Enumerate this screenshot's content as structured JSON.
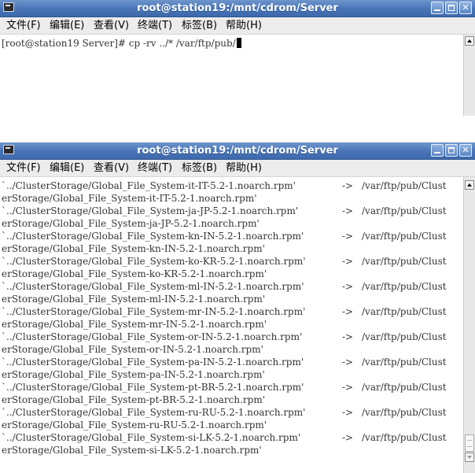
{
  "windows": [
    {
      "title": "root@station19:/mnt/cdrom/Server",
      "menu": [
        "文件(F)",
        "编辑(E)",
        "查看(V)",
        "终端(T)",
        "标签(B)",
        "帮助(H)"
      ],
      "lines": [
        "[root@station19 Server]# cp -rv ../* /var/ftp/pub/"
      ]
    },
    {
      "title": "root@station19:/mnt/cdrom/Server",
      "menu": [
        "文件(F)",
        "编辑(E)",
        "查看(V)",
        "终端(T)",
        "标签(B)",
        "帮助(H)"
      ],
      "arrow": "->",
      "dest": "/var/ftp/pub/Clust",
      "output": [
        {
          "src": "`../ClusterStorage/Global_File_System-it-IT-5.2-1.noarch.rpm'",
          "cont": "erStorage/Global_File_System-it-IT-5.2-1.noarch.rpm'"
        },
        {
          "src": "`../ClusterStorage/Global_File_System-ja-JP-5.2-1.noarch.rpm'",
          "cont": "erStorage/Global_File_System-ja-JP-5.2-1.noarch.rpm'"
        },
        {
          "src": "`../ClusterStorage/Global_File_System-kn-IN-5.2-1.noarch.rpm'",
          "cont": "erStorage/Global_File_System-kn-IN-5.2-1.noarch.rpm'"
        },
        {
          "src": "`../ClusterStorage/Global_File_System-ko-KR-5.2-1.noarch.rpm'",
          "cont": "erStorage/Global_File_System-ko-KR-5.2-1.noarch.rpm'"
        },
        {
          "src": "`../ClusterStorage/Global_File_System-ml-IN-5.2-1.noarch.rpm'",
          "cont": "erStorage/Global_File_System-ml-IN-5.2-1.noarch.rpm'"
        },
        {
          "src": "`../ClusterStorage/Global_File_System-mr-IN-5.2-1.noarch.rpm'",
          "cont": "erStorage/Global_File_System-mr-IN-5.2-1.noarch.rpm'"
        },
        {
          "src": "`../ClusterStorage/Global_File_System-or-IN-5.2-1.noarch.rpm'",
          "cont": "erStorage/Global_File_System-or-IN-5.2-1.noarch.rpm'"
        },
        {
          "src": "`../ClusterStorage/Global_File_System-pa-IN-5.2-1.noarch.rpm'",
          "cont": "erStorage/Global_File_System-pa-IN-5.2-1.noarch.rpm'"
        },
        {
          "src": "`../ClusterStorage/Global_File_System-pt-BR-5.2-1.noarch.rpm'",
          "cont": "erStorage/Global_File_System-pt-BR-5.2-1.noarch.rpm'"
        },
        {
          "src": "`../ClusterStorage/Global_File_System-ru-RU-5.2-1.noarch.rpm'",
          "cont": "erStorage/Global_File_System-ru-RU-5.2-1.noarch.rpm'"
        },
        {
          "src": "`../ClusterStorage/Global_File_System-si-LK-5.2-1.noarch.rpm'",
          "cont": "erStorage/Global_File_System-si-LK-5.2-1.noarch.rpm'"
        }
      ]
    }
  ],
  "colors": {
    "titlebar": "#4a76b8",
    "menubar": "#ececec",
    "terminal_bg": "#ffffff",
    "terminal_fg": "#333333"
  }
}
